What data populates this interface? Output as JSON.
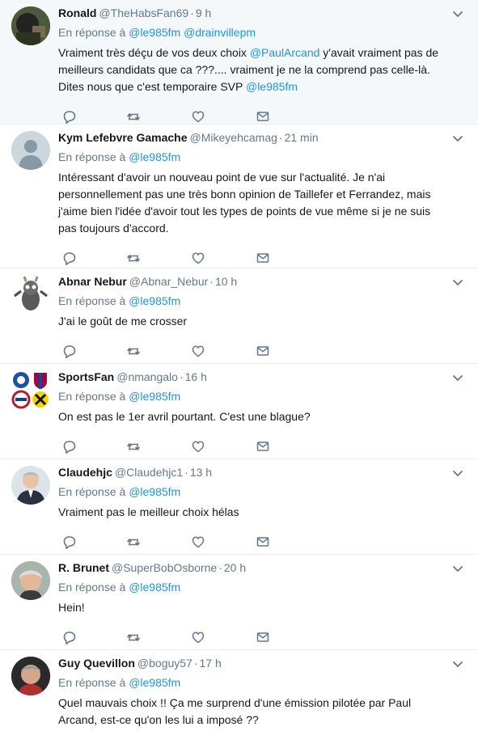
{
  "reply_prefix": "En réponse à",
  "icons": {
    "caret": "chevron-down-icon",
    "reply": "reply-icon",
    "retweet": "retweet-icon",
    "like": "heart-icon",
    "dm": "envelope-icon"
  },
  "colors": {
    "link": "#1b95e0",
    "muted": "#657786",
    "text": "#14171a",
    "highlight_bg": "#f5f8fa",
    "divider": "#e6ecf0"
  },
  "tweets": [
    {
      "name": "Ronald",
      "handle": "@TheHabsFan69",
      "sep": "·",
      "time": "9 h",
      "reply_to": [
        "@le985fm",
        "@drainvillepm"
      ],
      "text_parts": [
        "Vraiment très déçu de vos deux choix ",
        "@PaulArcand",
        " y'avait vraiment pas de meilleurs candidats que ca ???.... vraiment je ne la comprend pas celle-là. Dites nous que c'est temporaire SVP ",
        "@le985fm"
      ]
    },
    {
      "name": "Kym Lefebvre Gamache",
      "handle": "@Mikeyehcamag",
      "sep": "·",
      "time": "21 min",
      "reply_to": [
        "@le985fm"
      ],
      "text": "Intéressant d'avoir un nouveau point de vue sur l'actualité. Je n'ai personnellement pas une très bonn opinion de Taillefer et Ferrandez, mais j'aime bien l'idée d'avoir tout les types de points de vue même si je ne suis pas toujours d'accord."
    },
    {
      "name": "Abnar Nebur",
      "handle": "@Abnar_Nebur",
      "sep": "·",
      "time": "10 h",
      "reply_to": [
        "@le985fm"
      ],
      "text": "J'ai le goût de me crosser"
    },
    {
      "name": "SportsFan",
      "handle": "@nmangalo",
      "sep": "·",
      "time": "16 h",
      "reply_to": [
        "@le985fm"
      ],
      "text": "On est pas le 1er avril pourtant. C'est une blague?"
    },
    {
      "name": "Claudehjc",
      "handle": "@Claudehjc1",
      "sep": "·",
      "time": "13 h",
      "reply_to": [
        "@le985fm"
      ],
      "text": "Vraiment pas le meilleur choix hélas"
    },
    {
      "name": "R. Brunet",
      "handle": "@SuperBobOsborne",
      "sep": "·",
      "time": "20 h",
      "reply_to": [
        "@le985fm"
      ],
      "text": "Hein!"
    },
    {
      "name": "Guy Quevillon",
      "handle": "@boguy57",
      "sep": "·",
      "time": "17 h",
      "reply_to": [
        "@le985fm"
      ],
      "text": "Quel mauvais choix !! Ça me surprend d'une émission pilotée par Paul Arcand, est-ce qu'on les lui a imposé ??"
    }
  ]
}
